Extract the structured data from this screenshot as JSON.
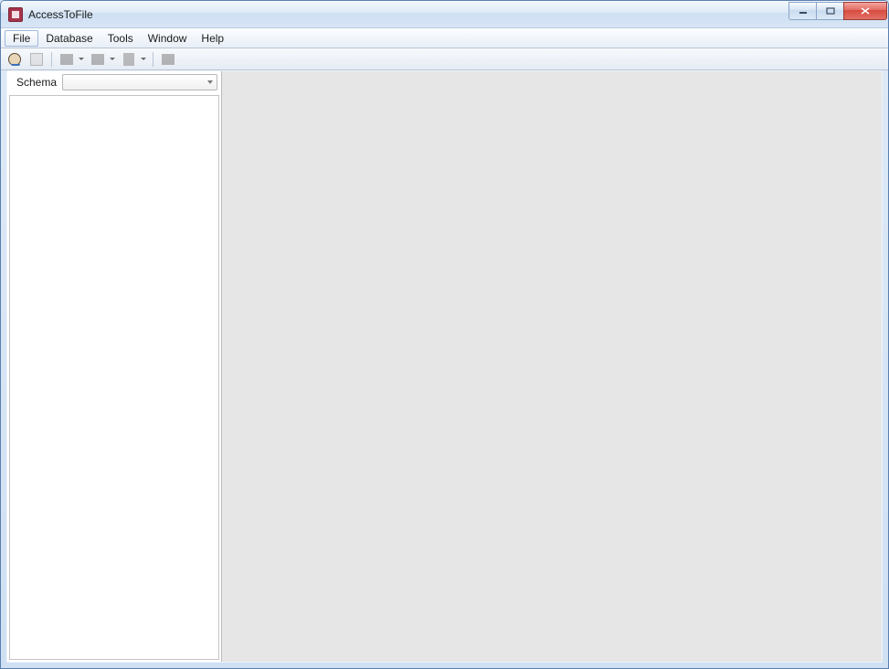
{
  "window": {
    "title": "AccessToFile"
  },
  "menu": {
    "items": [
      "File",
      "Database",
      "Tools",
      "Window",
      "Help"
    ],
    "active_index": 0
  },
  "toolbar": {
    "icons": {
      "user": "user-icon",
      "wizard": "wizard-icon",
      "export_table": "export-table-icon",
      "export_query": "export-query-icon",
      "sql": "sql-icon",
      "stop": "stop-icon"
    }
  },
  "sidebar": {
    "schema_label": "Schema",
    "schema_value": ""
  }
}
